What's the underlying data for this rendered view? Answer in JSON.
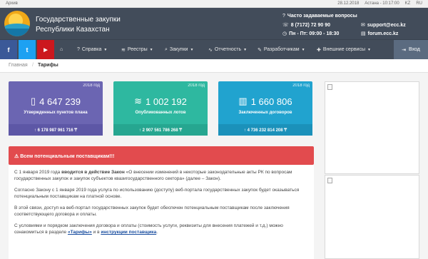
{
  "topbar": {
    "archive": "Архив",
    "date": "28.12.2018",
    "time": "Астана - 10:17:00",
    "lang_kz": "KZ",
    "lang_ru": "RU"
  },
  "header": {
    "title_line1": "Государственные закупки",
    "title_line2": "Республики Казахстан",
    "faq": "Часто задаваемые вопросы",
    "phone": "8 (7172) 72 90 90",
    "hours": "Пн - Пт: 09:00 - 18:30",
    "email": "support@ecc.kz",
    "forum": "forum.ecc.kz"
  },
  "social": {
    "facebook": "f",
    "twitter": "t",
    "youtube": "▶"
  },
  "nav": {
    "items": [
      {
        "label": "Справка",
        "icon": "help-icon"
      },
      {
        "label": "Реестры",
        "icon": "layers-icon"
      },
      {
        "label": "Закупки",
        "icon": "search-icon"
      },
      {
        "label": "Отчетность",
        "icon": "chart-icon"
      },
      {
        "label": "Разработчикам",
        "icon": "wrench-icon"
      },
      {
        "label": "Внешние сервисы",
        "icon": "puzzle-icon"
      }
    ],
    "login": "Вход"
  },
  "breadcrumb": {
    "home": "Главная",
    "separator": "/",
    "current": "Тарифы"
  },
  "cards": [
    {
      "year": "2018 год",
      "value": "4 647 239",
      "label": "Утвержденных пунктов плана",
      "total": "6 178 987 961 716 ₸",
      "color": "#6b65b2",
      "foot_color": "#5d57a6"
    },
    {
      "year": "2018 год",
      "value": "1 002 192",
      "label": "Опубликованных лотов",
      "total": "2 907 561 786 268 ₸",
      "color": "#2eb8a0",
      "foot_color": "#26a690"
    },
    {
      "year": "2018 год",
      "value": "1 660 806",
      "label": "Заключенных договоров",
      "total": "4 736 232 814 208 ₸",
      "color": "#21a3cf",
      "foot_color": "#1b91ba"
    }
  ],
  "alert": {
    "title": "Всем потенциальным поставщикам!!!"
  },
  "content": {
    "p1_a": "С 1 января 2019 года ",
    "p1_b": "вводится в действие Закон",
    "p1_c": " «О внесении изменений в некоторые законодательные акты РК по вопросам государственных закупок и закупок субъектов квазигосударственного сектора» (далее – Закон).",
    "p2": "Согласно Закону с 1 января 2019 года услуга по использованию (доступу) веб-портала государственных закупок будет оказываться потенциальным поставщикам на платной основе.",
    "p3": "В этой связи, доступ на веб-портал государственных закупок будет обеспечен потенциальным поставщикам после заключения соответствующего договора и оплаты.",
    "p4_a": "С условиями и порядком заключения договора и оплаты (стоимость услуги, реквизиты для внесения платежей и т.д.) можно ознакомиться в разделе ",
    "p4_link1": "«Тарифы»",
    "p4_b": " и в ",
    "p4_link2": "инструкции поставщика",
    "p4_c": "."
  }
}
